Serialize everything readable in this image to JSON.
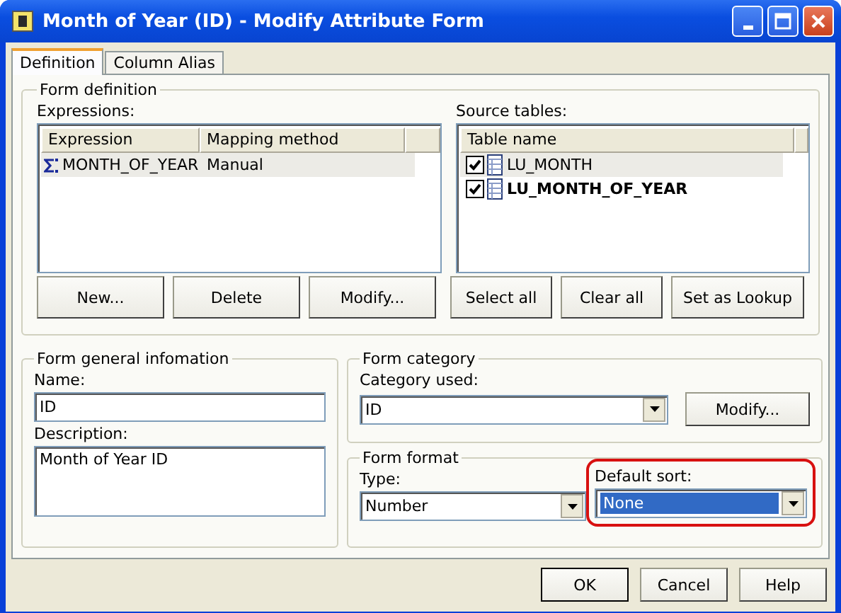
{
  "window": {
    "title": "Month of Year (ID) - Modify Attribute Form"
  },
  "tabs": [
    {
      "label": "Definition",
      "selected": true
    },
    {
      "label": "Column Alias",
      "selected": false
    }
  ],
  "form_definition": {
    "title": "Form definition",
    "expressions": {
      "label": "Expressions:",
      "columns": [
        "Expression",
        "Mapping method"
      ],
      "rows": [
        {
          "expression": "MONTH_OF_YEAR",
          "mapping_method": "Manual",
          "selected": true
        }
      ]
    },
    "source_tables": {
      "label": "Source tables:",
      "columns": [
        "Table name"
      ],
      "rows": [
        {
          "name": "LU_MONTH",
          "checked": true,
          "bold": false,
          "selected": true
        },
        {
          "name": "LU_MONTH_OF_YEAR",
          "checked": true,
          "bold": true,
          "selected": false
        }
      ]
    },
    "buttons": [
      "New...",
      "Delete",
      "Modify...",
      "Select all",
      "Clear all",
      "Set as Lookup"
    ]
  },
  "general": {
    "title": "Form general infomation",
    "name_label": "Name:",
    "name": "ID",
    "description_label": "Description:",
    "description": "Month of Year ID"
  },
  "category": {
    "title": "Form category",
    "label": "Category used:",
    "value": "ID",
    "button": "Modify..."
  },
  "format": {
    "title": "Form format",
    "type_label": "Type:",
    "type": "Number",
    "sort_label": "Default sort:",
    "sort": "None",
    "sort_focused": true,
    "sort_annotated": true
  },
  "dialog_buttons": [
    {
      "label": "OK",
      "default": true
    },
    {
      "label": "Cancel",
      "default": false
    },
    {
      "label": "Help",
      "default": false
    }
  ]
}
